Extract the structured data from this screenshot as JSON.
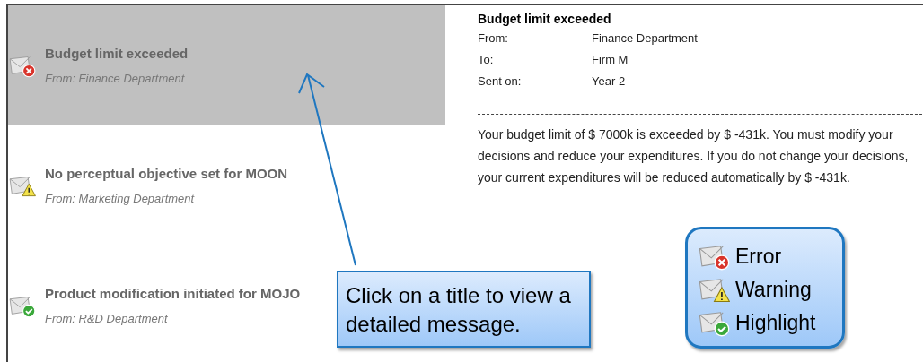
{
  "messages": [
    {
      "title": "Budget limit exceeded",
      "from": "From: Finance Department",
      "kind": "error",
      "selected": true
    },
    {
      "title": "No perceptual objective set for MOON",
      "from": "From: Marketing Department",
      "kind": "warning",
      "selected": false
    },
    {
      "title": "Product modification initiated for MOJO",
      "from": "From: R&D Department",
      "kind": "highlight",
      "selected": false
    }
  ],
  "detail": {
    "title": "Budget limit exceeded",
    "fields": [
      {
        "label": "From:",
        "value": "Finance Department"
      },
      {
        "label": "To:",
        "value": "Firm M"
      },
      {
        "label": "Sent on:",
        "value": "Year 2"
      }
    ],
    "body": "Your budget limit of $ 7000k is exceeded by $ -431k. You must modify your decisions and reduce your expenditures. If you do not change your decisions, your current expenditures will be reduced automatically by $ -431k."
  },
  "callout": "Click on a title to view a detailed message.",
  "legend": [
    {
      "label": "Error",
      "kind": "error"
    },
    {
      "label": "Warning",
      "kind": "warning"
    },
    {
      "label": "Highlight",
      "kind": "highlight"
    }
  ]
}
